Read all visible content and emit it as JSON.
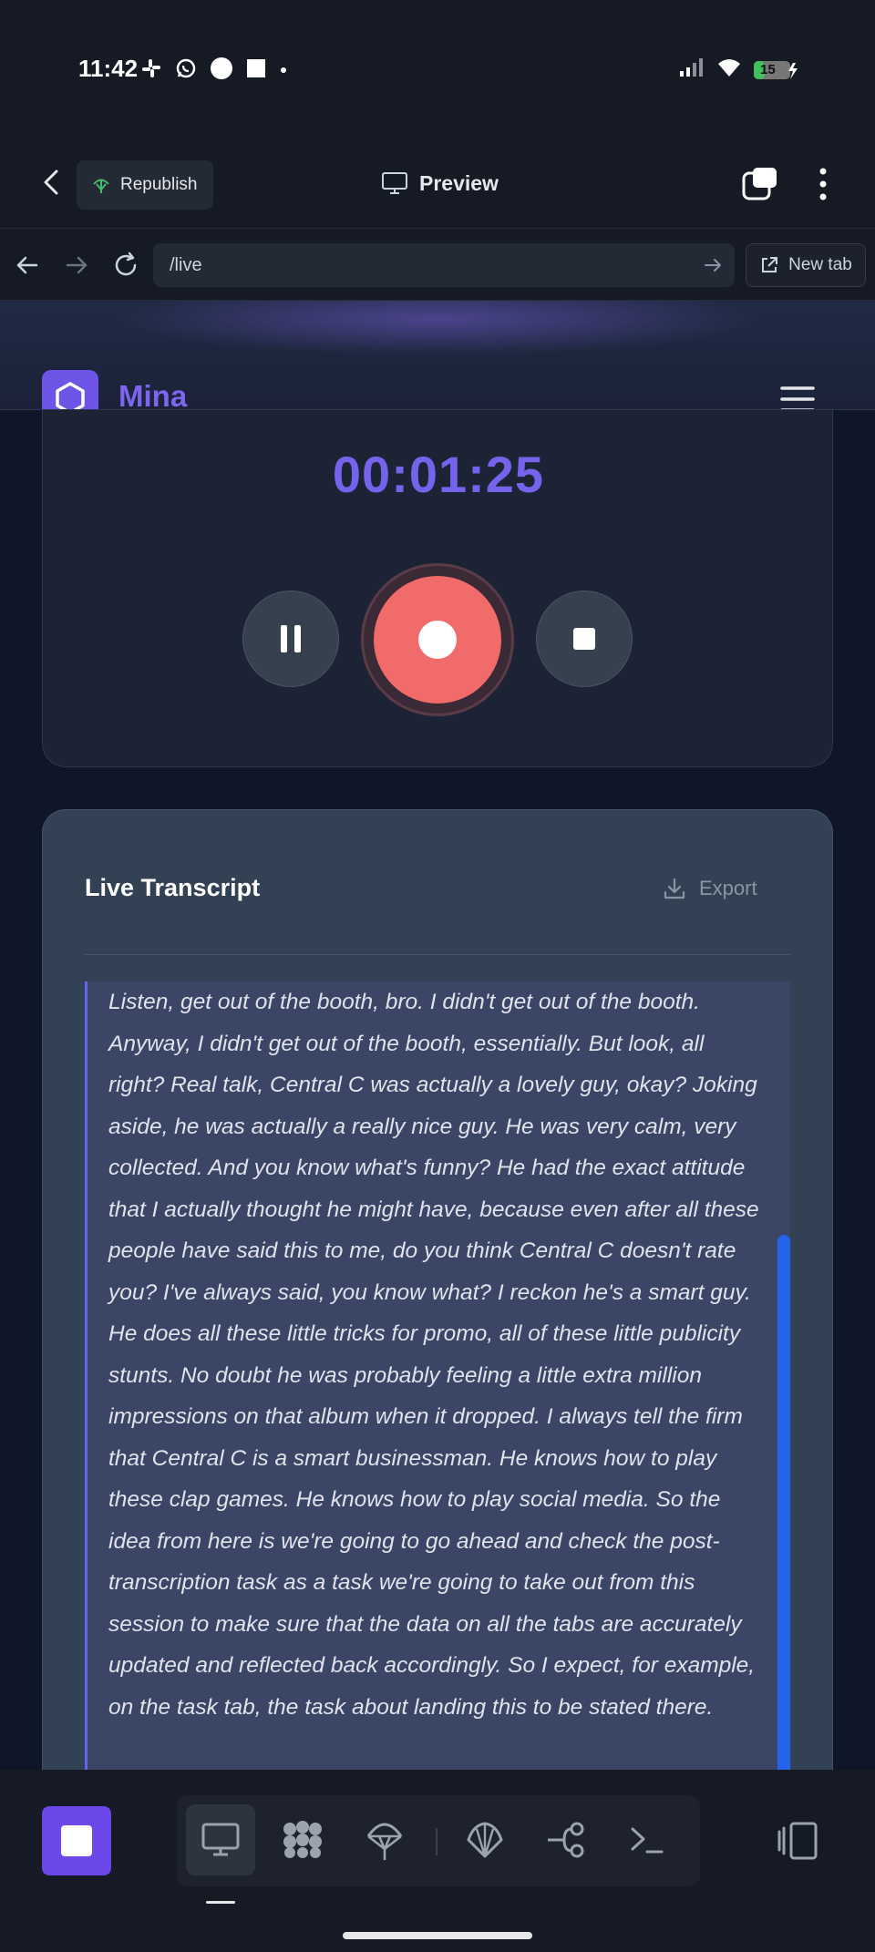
{
  "status_bar": {
    "time": "11:42",
    "battery": "15"
  },
  "app_bar": {
    "republish_label": "Republish",
    "preview_label": "Preview"
  },
  "url_bar": {
    "url": "/live",
    "new_tab_label": "New tab"
  },
  "site": {
    "name": "Mina"
  },
  "recorder": {
    "timer": "00:01:25"
  },
  "transcript": {
    "title": "Live Transcript",
    "export_label": "Export",
    "text": "Listen, get out of the booth, bro. I didn't get out of the booth. Anyway, I didn't get out of the booth, essentially. But look, all right? Real talk, Central C was actually a lovely guy, okay? Joking aside, he was actually a really nice guy. He was very calm, very collected. And you know what's funny? He had the exact attitude that I actually thought he might have, because even after all these people have said this to me, do you think Central C doesn't rate you? I've always said, you know what? I reckon he's a smart guy. He does all these little tricks for promo, all of these little publicity stunts. No doubt he was probably feeling a little extra million impressions on that album when it dropped. I always tell the firm that Central C is a smart businessman. He knows how to play these clap games. He knows how to play social media. So the idea from here is we're going to go ahead and check the post-transcription task as a task we're going to take out from this session to make sure that the data on all the tabs are accurately updated and reflected back accordingly. So I expect, for example, on the task tab, the task about landing this to be stated there."
  },
  "colors": {
    "accent": "#6e55e8",
    "timer": "#7563ec",
    "record": "#f26b6b",
    "scroll_thumb": "#2563eb"
  }
}
